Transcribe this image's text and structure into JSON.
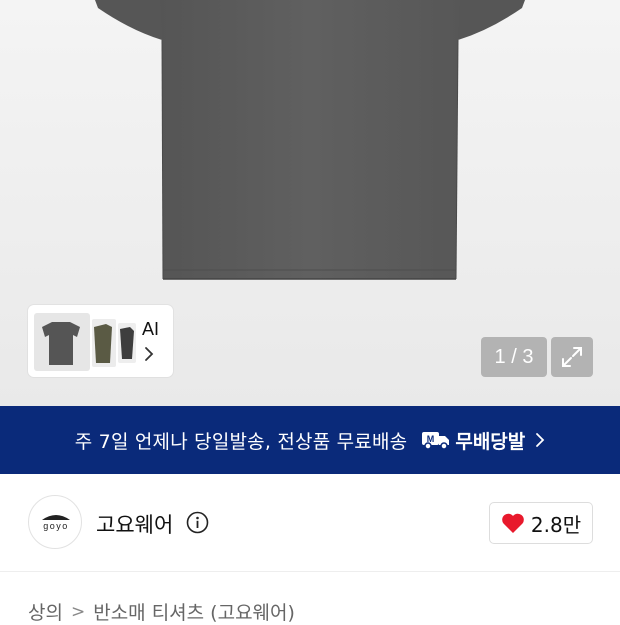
{
  "gallery": {
    "ai_label": "AI",
    "counter": "1 / 3",
    "shirt_color": "#5b5b5b"
  },
  "banner": {
    "text": "주 7일 언제나 당일발송, 전상품 무료배송",
    "free_shipping_label": "무배당발",
    "background": "#0a2a7a"
  },
  "brand": {
    "name": "고요웨어",
    "logo_text": "goyo",
    "like_count": "2.8만",
    "heart_color": "#e8192c"
  },
  "breadcrumb": {
    "items": [
      "상의",
      "반소매 티셔츠 (고요웨어)"
    ]
  }
}
